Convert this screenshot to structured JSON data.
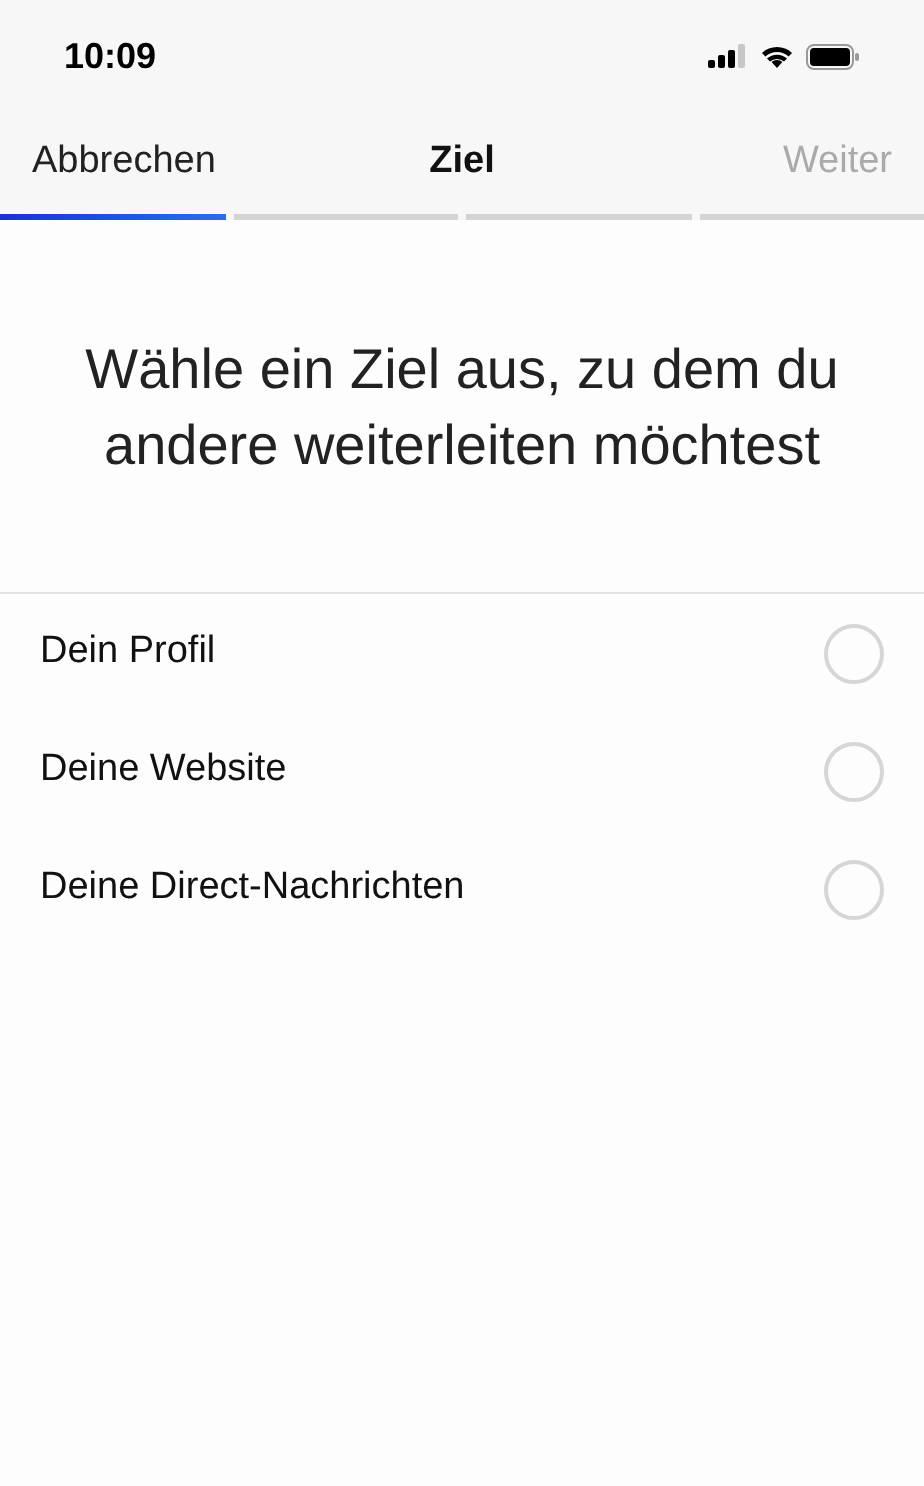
{
  "status_bar": {
    "time": "10:09"
  },
  "nav": {
    "cancel": "Abbrechen",
    "title": "Ziel",
    "next": {
      "label": "Weiter",
      "disabled": true
    }
  },
  "progress_steps": [
    {
      "done": true
    },
    {
      "done": false
    },
    {
      "done": false
    },
    {
      "done": false
    }
  ],
  "heading": "Wähle ein Ziel aus, zu dem du andere weiterleiten möchtest",
  "options": [
    {
      "label": "Dein Profil",
      "selected": false
    },
    {
      "label": "Deine Website",
      "selected": false
    },
    {
      "label": "Deine Direct-Nachrichten",
      "selected": false
    }
  ]
}
